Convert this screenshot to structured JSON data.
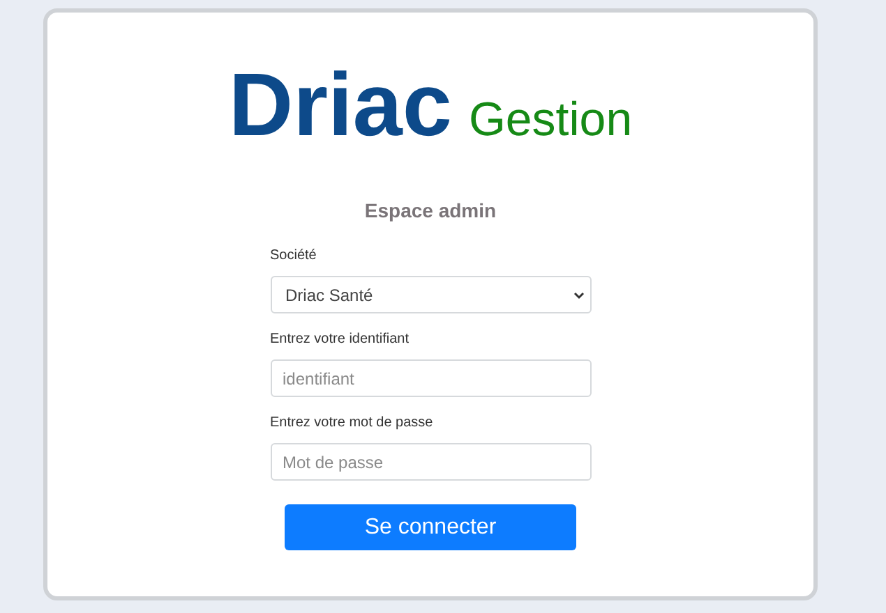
{
  "logo": {
    "brand": "Driac",
    "product": "Gestion"
  },
  "heading": "Espace admin",
  "fields": [
    {
      "kind": "select",
      "label": "Société",
      "value": "Driac Santé"
    },
    {
      "kind": "text",
      "label": "Entrez votre identifiant",
      "placeholder": "identifiant"
    },
    {
      "kind": "password",
      "label": "Entrez votre mot de passe",
      "placeholder": "Mot de passe"
    }
  ],
  "submit": "Se connecter"
}
